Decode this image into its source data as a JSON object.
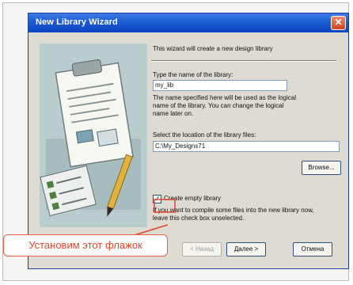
{
  "window": {
    "title": "New Library Wizard"
  },
  "wizard": {
    "intro": "This wizard will create a new design library",
    "name_label": "Type the name of the library:",
    "name_value": "my_lib",
    "name_note": "The name specified here will be used as the logical name of the library. You can change the logical name later on.",
    "location_label": "Select the location of the library files:",
    "location_value": "C:\\My_Designs71",
    "browse_label": "Browse...",
    "checkbox_label": "Create empty library",
    "checkbox_checked": true,
    "checkbox_note": "If you want to compile some files into the new library now, leave this check box unselected."
  },
  "footer": {
    "back_label": "< Назад",
    "next_label": "Далее >",
    "cancel_label": "Отмена"
  },
  "annotation": {
    "text": "Установим этот флажок"
  },
  "icons": {
    "close": "close-icon",
    "check": "checkmark-icon",
    "illustration": "wizard-illustration"
  },
  "colors": {
    "titlebar": "#0b44c0",
    "callout": "#e0452f",
    "dialog_bg": "#dedbd3"
  }
}
